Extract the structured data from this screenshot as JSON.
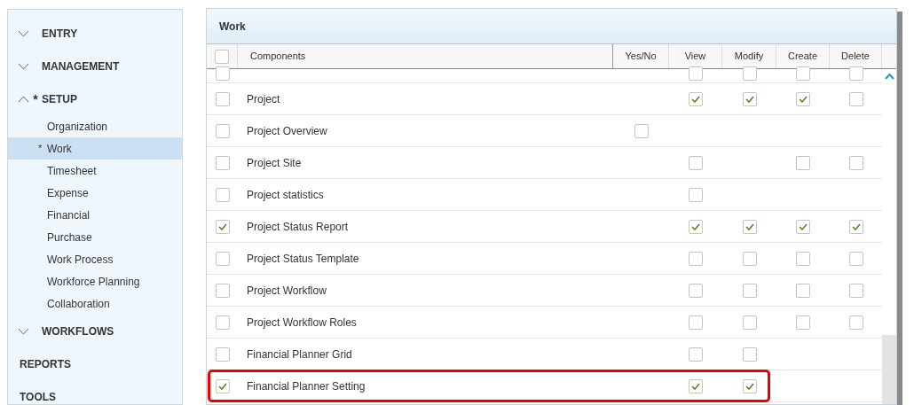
{
  "sidebar": {
    "items": [
      {
        "label": "ENTRY",
        "kind": "section",
        "expanded": false
      },
      {
        "label": "MANAGEMENT",
        "kind": "section",
        "expanded": false
      },
      {
        "label": "SETUP",
        "kind": "section",
        "expanded": true,
        "marker": "*",
        "children": [
          {
            "label": "Organization",
            "selected": false
          },
          {
            "label": "Work",
            "marker": "*",
            "selected": true
          },
          {
            "label": "Timesheet",
            "selected": false
          },
          {
            "label": "Expense",
            "selected": false
          },
          {
            "label": "Financial",
            "selected": false
          },
          {
            "label": "Purchase",
            "selected": false
          },
          {
            "label": "Work Process",
            "selected": false
          },
          {
            "label": "Workforce Planning",
            "selected": false
          },
          {
            "label": "Collaboration",
            "selected": false
          }
        ]
      },
      {
        "label": "WORKFLOWS",
        "kind": "section",
        "expanded": false
      },
      {
        "label": "REPORTS",
        "kind": "link"
      },
      {
        "label": "TOOLS",
        "kind": "link"
      }
    ]
  },
  "panel": {
    "title": "Work",
    "table": {
      "select_all": false,
      "columns": [
        "Components",
        "Yes/No",
        "View",
        "Modify",
        "Create",
        "Delete"
      ],
      "rows": [
        {
          "kind": "cut",
          "checked": false,
          "cells": [
            null,
            false,
            false,
            false,
            false
          ]
        },
        {
          "kind": "full",
          "label": "Project",
          "checked": false,
          "highlighted": false,
          "cells": [
            null,
            true,
            true,
            true,
            false
          ]
        },
        {
          "kind": "full",
          "label": "Project Overview",
          "checked": false,
          "highlighted": false,
          "cells": [
            false,
            null,
            null,
            null,
            null
          ]
        },
        {
          "kind": "full",
          "label": "Project Site",
          "checked": false,
          "highlighted": false,
          "cells": [
            null,
            false,
            null,
            false,
            false
          ]
        },
        {
          "kind": "full",
          "label": "Project statistics",
          "checked": false,
          "highlighted": false,
          "cells": [
            null,
            false,
            null,
            null,
            null
          ]
        },
        {
          "kind": "full",
          "label": "Project Status Report",
          "checked": true,
          "highlighted": false,
          "cells": [
            null,
            true,
            true,
            true,
            true
          ]
        },
        {
          "kind": "full",
          "label": "Project Status Template",
          "checked": false,
          "highlighted": false,
          "cells": [
            null,
            false,
            false,
            false,
            false
          ]
        },
        {
          "kind": "full",
          "label": "Project Workflow",
          "checked": false,
          "highlighted": false,
          "cells": [
            null,
            false,
            false,
            false,
            false
          ]
        },
        {
          "kind": "full",
          "label": "Project Workflow Roles",
          "checked": false,
          "highlighted": false,
          "cells": [
            null,
            false,
            false,
            false,
            false
          ]
        },
        {
          "kind": "full",
          "label": "Financial Planner Grid",
          "checked": false,
          "highlighted": false,
          "cells": [
            null,
            false,
            false,
            null,
            null
          ]
        },
        {
          "kind": "full",
          "label": "Financial Planner Setting",
          "checked": true,
          "highlighted": true,
          "cells": [
            null,
            true,
            true,
            null,
            null
          ]
        }
      ]
    }
  }
}
